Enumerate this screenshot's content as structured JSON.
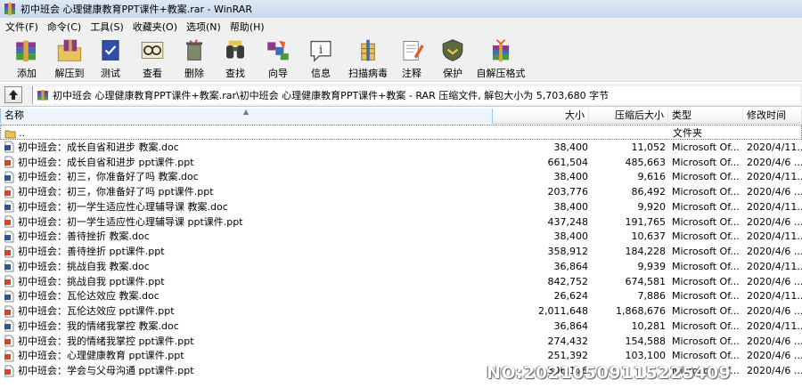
{
  "window": {
    "title": "初中班会 心理健康教育PPT课件+教案.rar - WinRAR"
  },
  "menu": [
    "文件(F)",
    "命令(C)",
    "工具(S)",
    "收藏夹(O)",
    "选项(N)",
    "帮助(H)"
  ],
  "toolbar": [
    {
      "label": "添加",
      "icon": "add-archive-icon"
    },
    {
      "label": "解压到",
      "icon": "extract-to-icon"
    },
    {
      "label": "测试",
      "icon": "test-icon"
    },
    {
      "label": "查看",
      "icon": "view-icon"
    },
    {
      "label": "删除",
      "icon": "delete-icon"
    },
    {
      "label": "查找",
      "icon": "find-icon"
    },
    {
      "label": "向导",
      "icon": "wizard-icon"
    },
    {
      "label": "信息",
      "icon": "info-icon"
    },
    {
      "label": "扫描病毒",
      "icon": "virus-scan-icon"
    },
    {
      "label": "注释",
      "icon": "comment-icon"
    },
    {
      "label": "保护",
      "icon": "protect-icon"
    },
    {
      "label": "自解压格式",
      "icon": "sfx-icon"
    }
  ],
  "address": {
    "path": "初中班会 心理健康教育PPT课件+教案.rar\\初中班会 心理健康教育PPT课件+教案 - RAR 压缩文件, 解包大小为 5,703,680 字节"
  },
  "columns": {
    "name": "名称",
    "size": "大小",
    "packed": "压缩后大小",
    "type": "类型",
    "modified": "修改时间"
  },
  "updir": {
    "name": "..",
    "type": "文件夹"
  },
  "files": [
    {
      "name": "初中班会：成长自省和进步  教案.doc",
      "kind": "doc",
      "size": "38,400",
      "packed": "11,052",
      "type": "Microsoft Of...",
      "modified": "2020/4/11..."
    },
    {
      "name": "初中班会：成长自省和进步  ppt课件.ppt",
      "kind": "ppt",
      "size": "661,504",
      "packed": "485,663",
      "type": "Microsoft Of...",
      "modified": "2020/4/6 ..."
    },
    {
      "name": "初中班会：初三，你准备好了吗  教案.doc",
      "kind": "doc",
      "size": "38,400",
      "packed": "9,616",
      "type": "Microsoft Of...",
      "modified": "2020/4/11..."
    },
    {
      "name": "初中班会：初三，你准备好了吗  ppt课件.ppt",
      "kind": "ppt",
      "size": "203,776",
      "packed": "86,492",
      "type": "Microsoft Of...",
      "modified": "2020/4/6 ..."
    },
    {
      "name": "初中班会：初一学生适应性心理辅导课  教案.doc",
      "kind": "doc",
      "size": "38,400",
      "packed": "9,920",
      "type": "Microsoft Of...",
      "modified": "2020/4/11..."
    },
    {
      "name": "初中班会：初一学生适应性心理辅导课  ppt课件.ppt",
      "kind": "ppt",
      "size": "437,248",
      "packed": "191,765",
      "type": "Microsoft Of...",
      "modified": "2020/4/6 ..."
    },
    {
      "name": "初中班会：善待挫折  教案.doc",
      "kind": "doc",
      "size": "38,400",
      "packed": "10,637",
      "type": "Microsoft Of...",
      "modified": "2020/4/11..."
    },
    {
      "name": "初中班会：善待挫折  ppt课件.ppt",
      "kind": "ppt",
      "size": "358,912",
      "packed": "184,228",
      "type": "Microsoft Of...",
      "modified": "2020/4/6 ..."
    },
    {
      "name": "初中班会：挑战自我  教案.doc",
      "kind": "doc",
      "size": "36,864",
      "packed": "9,939",
      "type": "Microsoft Of...",
      "modified": "2020/4/11..."
    },
    {
      "name": "初中班会：挑战自我  ppt课件.ppt",
      "kind": "ppt",
      "size": "842,752",
      "packed": "674,581",
      "type": "Microsoft Of...",
      "modified": "2020/4/6 ..."
    },
    {
      "name": "初中班会：瓦伦达效应  教案.doc",
      "kind": "doc",
      "size": "26,624",
      "packed": "7,886",
      "type": "Microsoft Of...",
      "modified": "2020/4/11..."
    },
    {
      "name": "初中班会：瓦伦达效应  ppt课件.ppt",
      "kind": "ppt",
      "size": "2,011,648",
      "packed": "1,868,676",
      "type": "Microsoft Of...",
      "modified": "2020/4/6 ..."
    },
    {
      "name": "初中班会：我的情绪我掌控  教案.doc",
      "kind": "doc",
      "size": "36,864",
      "packed": "10,281",
      "type": "Microsoft Of...",
      "modified": "2020/4/11..."
    },
    {
      "name": "初中班会：我的情绪我掌控  ppt课件.ppt",
      "kind": "ppt",
      "size": "274,432",
      "packed": "154,588",
      "type": "Microsoft Of...",
      "modified": "2020/4/6 ..."
    },
    {
      "name": "初中班会：心理健康教育  ppt课件.ppt",
      "kind": "ppt",
      "size": "251,392",
      "packed": "103,100",
      "type": "Microsoft Of...",
      "modified": "2020/4/6 ..."
    },
    {
      "name": "初中班会：学会与父母沟通  ppt课件.ppt",
      "kind": "ppt",
      "size": "306,176",
      "packed": "",
      "type": "Microsoft Of...",
      "modified": "2020/4/6 ..."
    }
  ],
  "watermark": "NO:20210509115225409",
  "colors": {
    "title_bg": "#c7d7ec",
    "menu_bg": "#f0f0f0",
    "header_sorted": "#eef4fb",
    "doc_icon": "#2b5797",
    "ppt_icon": "#d24726",
    "folder": "#e8c25a"
  }
}
